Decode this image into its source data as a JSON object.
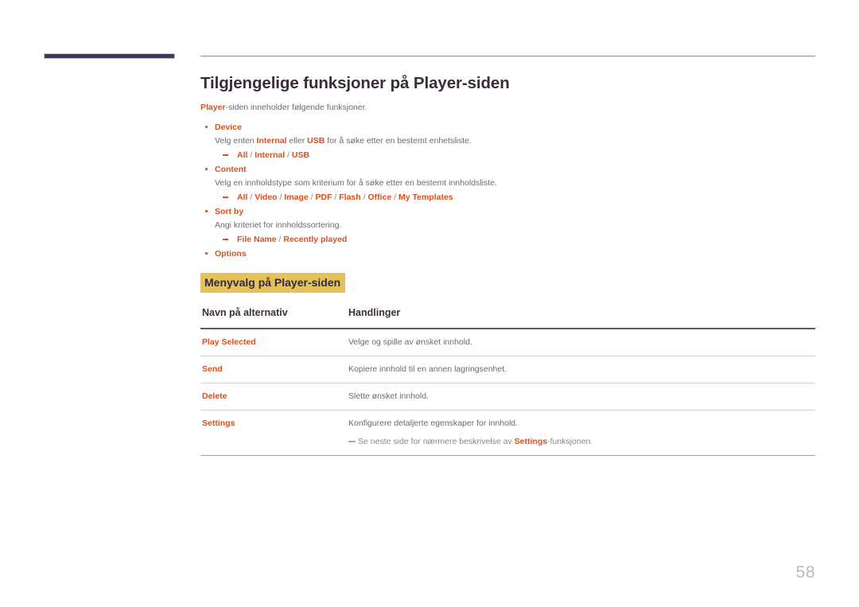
{
  "document": {
    "page_number": "58"
  },
  "header": {
    "title": "Tilgjengelige funksjoner på Player-siden",
    "intro_prefix": "Player",
    "intro_rest": "-siden inneholder følgende funksjoner."
  },
  "bullets": [
    {
      "title": "Device",
      "desc_parts": [
        {
          "text": "Velg enten ",
          "style": "plain"
        },
        {
          "text": "Internal",
          "style": "accent"
        },
        {
          "text": " eller ",
          "style": "plain"
        },
        {
          "text": "USB",
          "style": "accent"
        },
        {
          "text": " for å søke etter en bestemt enhetsliste.",
          "style": "plain"
        }
      ],
      "options": [
        "All",
        "Internal",
        "USB"
      ]
    },
    {
      "title": "Content",
      "desc_parts": [
        {
          "text": "Velg en innholdstype som kriterium for å søke etter en bestemt innholdsliste.",
          "style": "plain"
        }
      ],
      "options": [
        "All",
        "Video",
        "Image",
        "PDF",
        "Flash",
        "Office",
        "My Templates"
      ]
    },
    {
      "title": "Sort by",
      "desc_parts": [
        {
          "text": "Angi kriteriet for innholdssortering.",
          "style": "plain"
        }
      ],
      "options": [
        "File Name",
        "Recently played"
      ]
    },
    {
      "title": "Options",
      "desc_parts": [],
      "options": []
    }
  ],
  "section": {
    "heading": "Menyvalg på Player-siden"
  },
  "table": {
    "columns": [
      "Navn på alternativ",
      "Handlinger"
    ],
    "rows": [
      {
        "name": "Play Selected",
        "desc": "Velge og spille av ønsket innhold.",
        "note": null
      },
      {
        "name": "Send",
        "desc": "Kopiere innhold til en annen lagringsenhet.",
        "note": null
      },
      {
        "name": "Delete",
        "desc": "Slette ønsket innhold.",
        "note": null
      },
      {
        "name": "Settings",
        "desc": "Konfigurere detaljerte egenskaper for innhold.",
        "note": {
          "prefix": "Se neste side for nærmere beskrivelse av ",
          "emphasis": "Settings",
          "suffix": "-funksjonen."
        }
      }
    ]
  },
  "colors": {
    "accent": "#d9501e",
    "heading": "#3c2b38",
    "highlight_bg": "#e6c159",
    "highlight_text": "#2d2b4a",
    "body_text": "#6b6b6b",
    "nav_block": "#3e3a56",
    "page_number": "#b9b9c4"
  }
}
